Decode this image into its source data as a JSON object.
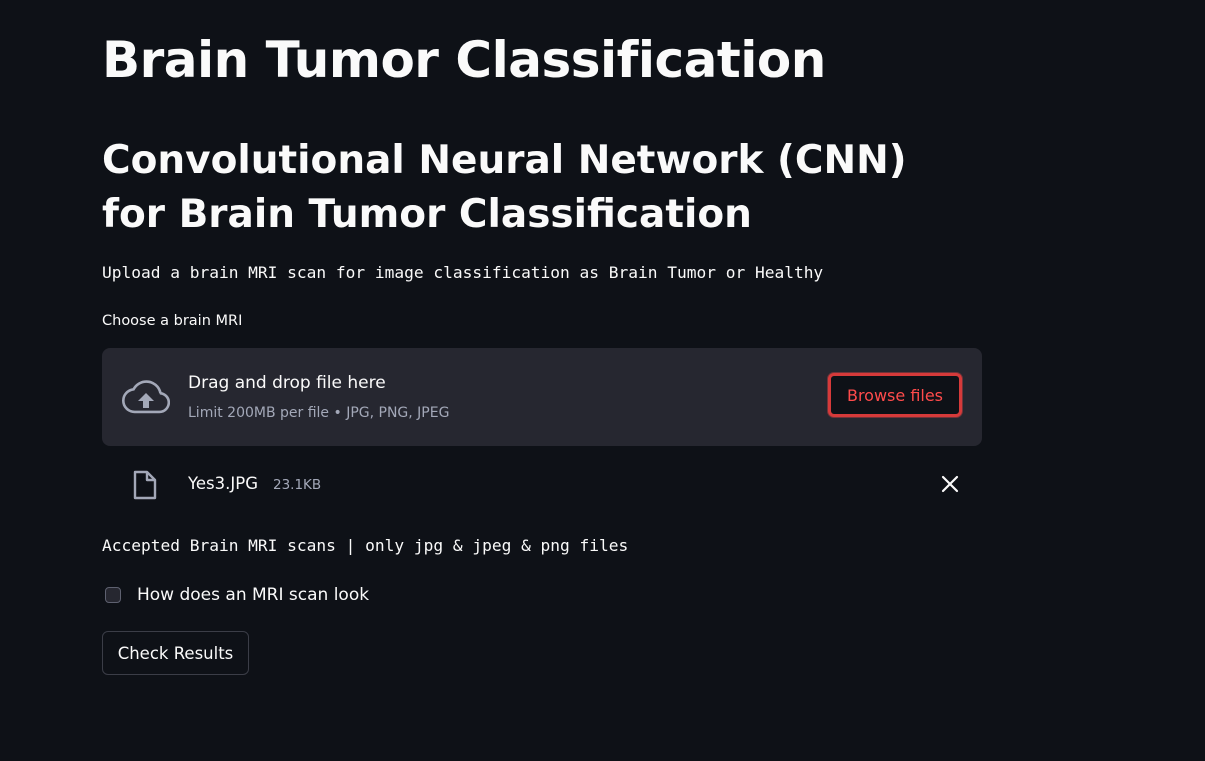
{
  "page": {
    "title": "Brain Tumor Classification",
    "subtitle": "Convolutional Neural Network (CNN) for Brain Tumor Classification",
    "intro_text": "Upload a brain MRI scan for image classification as Brain Tumor or Healthy"
  },
  "uploader": {
    "label": "Choose a brain MRI",
    "drop_title": "Drag and drop file here",
    "drop_limit": "Limit 200MB per file • JPG, PNG, JPEG",
    "browse_label": "Browse files",
    "upload_icon": "cloud-upload-icon"
  },
  "uploaded_file": {
    "name": "Yes3.JPG",
    "size": "23.1KB",
    "file_icon": "file-icon",
    "remove_icon": "close-icon"
  },
  "accepted_note": "Accepted Brain MRI scans | only jpg & jpeg & png files",
  "checkbox": {
    "label": "How does an MRI scan look",
    "checked": false
  },
  "check_button_label": "Check Results",
  "colors": {
    "background": "#0e1117",
    "surface": "#262730",
    "accent": "#ff4b4b",
    "text": "#fafafa",
    "muted_text": "#a3a8b8"
  }
}
